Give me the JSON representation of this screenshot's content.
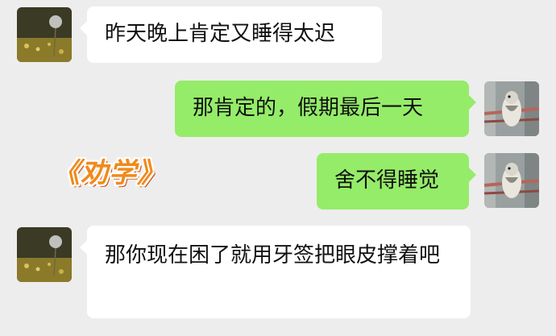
{
  "colors": {
    "background": "#ededed",
    "received_bubble": "#ffffff",
    "sent_bubble": "#95ec69",
    "text": "#111111",
    "caption": "#f08a1c"
  },
  "messages": [
    {
      "side": "left",
      "text": "昨天晚上肯定又睡得太迟"
    },
    {
      "side": "right",
      "text": "那肯定的，假期最后一天"
    },
    {
      "side": "right",
      "text": "舍不得睡觉"
    },
    {
      "side": "left",
      "text": "那你现在困了就用牙签把眼皮撑着吧"
    }
  ],
  "caption": "《劝学》",
  "avatars": {
    "left": "dandelion-photo-avatar",
    "right": "bird-photo-avatar"
  }
}
